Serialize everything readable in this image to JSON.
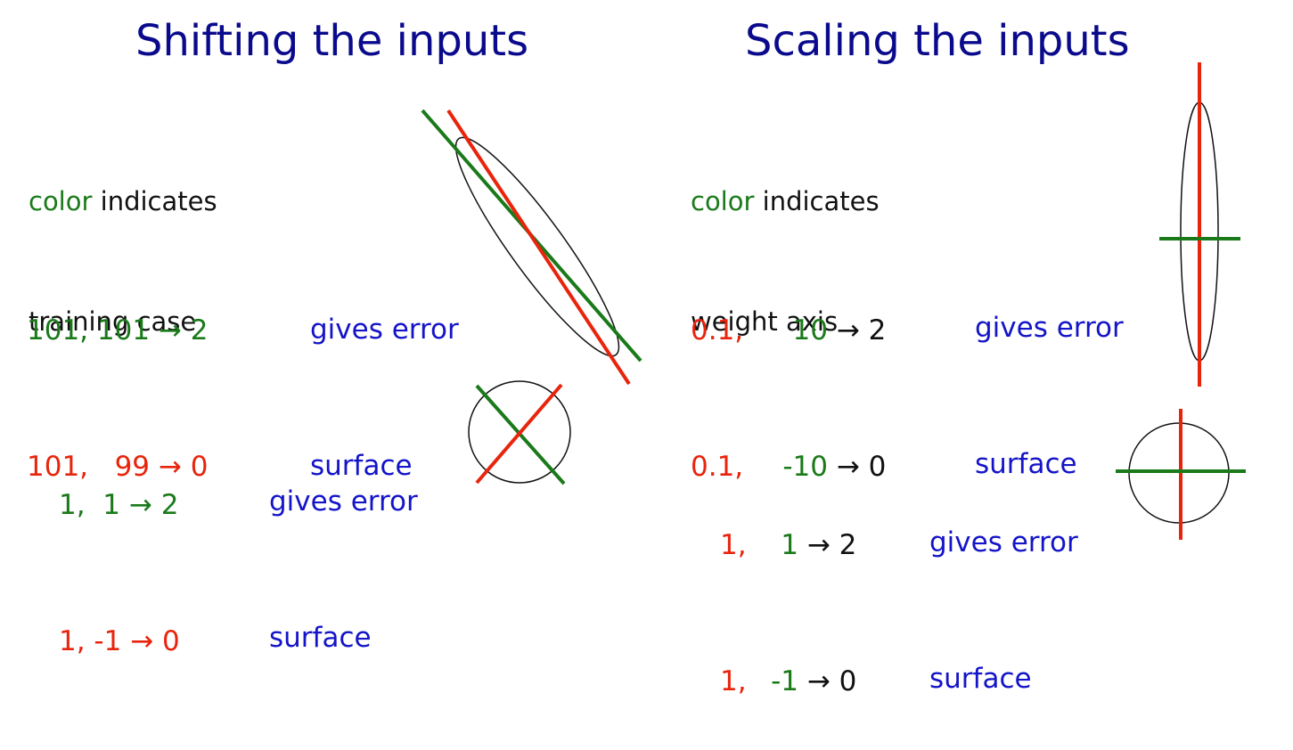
{
  "colors": {
    "title": "#0a0a8c",
    "green": "#1a7a1a",
    "red": "#e8240c",
    "blue": "#1414c8",
    "black": "#111111"
  },
  "left": {
    "title": "Shifting the inputs",
    "note": {
      "word1": "color",
      "word2": " indicates",
      "line2": "training case"
    },
    "block1": {
      "rows": [
        {
          "color": "green",
          "text": "101, 101 → 2"
        },
        {
          "color": "red",
          "text": "101,   99 → 0"
        }
      ],
      "gives": [
        "gives error",
        "surface"
      ]
    },
    "block2": {
      "rows": [
        {
          "color": "green",
          "text": "1,  1 → 2"
        },
        {
          "color": "red",
          "text": "1, -1 → 0"
        }
      ],
      "gives": [
        "gives error",
        "surface"
      ]
    }
  },
  "right": {
    "title": "Scaling the inputs",
    "note": {
      "word1": "color",
      "word2": " indicates",
      "line2": "weight axis"
    },
    "block1": {
      "row1": {
        "a": "0.1,",
        "b": "10",
        "c": " → 2"
      },
      "row2": {
        "a": "0.1,",
        "b": "-10",
        "c": " → 0"
      },
      "gives": [
        "gives error",
        "surface"
      ]
    },
    "block2": {
      "row1": {
        "a": "1,",
        "b": "1",
        "c": " → 2"
      },
      "row2": {
        "a": "1,",
        "b": "-1",
        "c": " → 0"
      },
      "gives": [
        "gives error",
        "surface"
      ]
    }
  }
}
